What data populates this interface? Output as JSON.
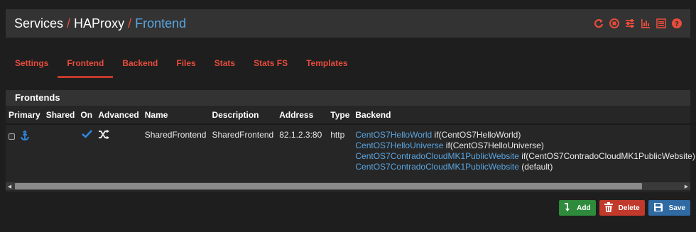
{
  "breadcrumb": {
    "services": "Services",
    "haproxy": "HAProxy",
    "frontend": "Frontend",
    "separator": "/"
  },
  "header_icons": [
    "restart-icon",
    "stop-icon",
    "sliders-icon",
    "bar-chart-icon",
    "list-icon",
    "help-icon"
  ],
  "tabs": [
    {
      "label": "Settings",
      "active": false
    },
    {
      "label": "Frontend",
      "active": true
    },
    {
      "label": "Backend",
      "active": false
    },
    {
      "label": "Files",
      "active": false
    },
    {
      "label": "Stats",
      "active": false
    },
    {
      "label": "Stats FS",
      "active": false
    },
    {
      "label": "Templates",
      "active": false
    }
  ],
  "panel": {
    "title": "Frontends"
  },
  "table": {
    "columns": [
      "Primary",
      "Shared",
      "On",
      "Advanced",
      "Name",
      "Description",
      "Address",
      "Type",
      "Backend"
    ],
    "rows": [
      {
        "name": "SharedFrontend",
        "description": "SharedFrontend",
        "address": "82.1.2.3:80",
        "type": "http",
        "backends": [
          {
            "link": "CentOS7HelloWorld",
            "cond": " if(CentOS7HelloWorld)"
          },
          {
            "link": "CentOS7HelloUniverse",
            "cond": " if(CentOS7HelloUniverse)"
          },
          {
            "link": "CentOS7ContradoCloudMK1PublicWebsite",
            "cond": " if(CentOS7ContradoCloudMK1PublicWebsite)"
          },
          {
            "link": "CentOS7ContradoCloudMK1PublicWebsite",
            "cond": " (default)"
          }
        ]
      }
    ]
  },
  "buttons": {
    "add": "Add",
    "delete": "Delete",
    "save": "Save"
  },
  "colors": {
    "accent": "#e74c3c",
    "link": "#5aa5e0",
    "add": "#2e8b3c",
    "delete": "#c0392b",
    "save": "#2f6aa3"
  }
}
